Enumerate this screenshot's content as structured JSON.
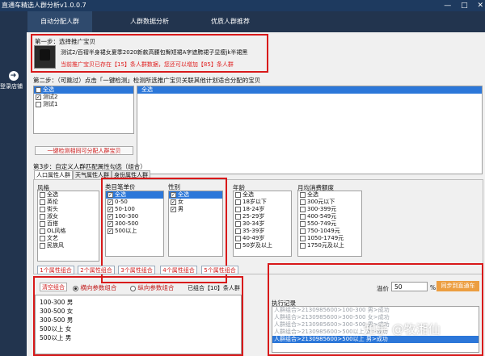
{
  "app": {
    "title": "直通车精选人群分析v1.0.0.7"
  },
  "window_controls": {
    "minimize": "—",
    "maximize": "□",
    "close": "✕"
  },
  "nav": {
    "tabs": [
      "自动分配人群",
      "人群数据分析",
      "优质人群推荐"
    ],
    "active": 0
  },
  "sidebar": {
    "login_label": "登录店铺",
    "login_icon": "arrow-right-circle-icon"
  },
  "step1": {
    "title": "第一步：选择推广宝贝",
    "product_name": "测试2/百褶半身裙女夏季2020新款高腰包臀短裙A字遮胯裙子显瘦jk半裙黑",
    "notice": "当前推广宝贝已存在【15】条人群数据，您还可以增加【85】条人群"
  },
  "step2": {
    "title": "第二步：（可跳过）点击「一键检测」检测所选推广宝贝关联其他计划适合分配的宝贝",
    "left_list": [
      {
        "label": "全选",
        "checked": false,
        "selected": true
      },
      {
        "label": "测试2",
        "checked": true,
        "selected": false
      },
      {
        "label": "测试1",
        "checked": false,
        "selected": false
      }
    ],
    "right_list": [
      {
        "label": "全选",
        "selected": true
      }
    ],
    "detect_button": "一键检测相同可分配人群宝贝"
  },
  "step3": {
    "title": "第3步：自定义人群匹配属性勾选（组合）",
    "tabs": [
      "人口属性人群",
      "天气属性人群",
      "身份属性人群"
    ],
    "active_tab": 0,
    "groups": [
      {
        "name": "风格",
        "items": [
          {
            "label": "全选",
            "checked": false
          },
          {
            "label": "英伦",
            "checked": false
          },
          {
            "label": "街头",
            "checked": false
          },
          {
            "label": "淑女",
            "checked": false
          },
          {
            "label": "百搭",
            "checked": false
          },
          {
            "label": "OL风格",
            "checked": false
          },
          {
            "label": "文艺",
            "checked": false
          },
          {
            "label": "民族风",
            "checked": false
          }
        ]
      },
      {
        "name": "类目笔单价",
        "items": [
          {
            "label": "全选",
            "checked": true,
            "selected": true
          },
          {
            "label": "0-50",
            "checked": true
          },
          {
            "label": "50-100",
            "checked": true
          },
          {
            "label": "100-300",
            "checked": true
          },
          {
            "label": "300-500",
            "checked": true
          },
          {
            "label": "500以上",
            "checked": true
          }
        ]
      },
      {
        "name": "性别",
        "items": [
          {
            "label": "全选",
            "checked": true,
            "selected": true
          },
          {
            "label": "女",
            "checked": true
          },
          {
            "label": "男",
            "checked": true
          }
        ]
      },
      {
        "name": "年龄",
        "items": [
          {
            "label": "全选",
            "checked": false
          },
          {
            "label": "18岁以下",
            "checked": false
          },
          {
            "label": "18-24岁",
            "checked": false
          },
          {
            "label": "25-29岁",
            "checked": false
          },
          {
            "label": "30-34岁",
            "checked": false
          },
          {
            "label": "35-39岁",
            "checked": false
          },
          {
            "label": "40-49岁",
            "checked": false
          },
          {
            "label": "50岁及以上",
            "checked": false
          }
        ]
      },
      {
        "name": "月均消费额度",
        "items": [
          {
            "label": "全选",
            "checked": false
          },
          {
            "label": "300元以下",
            "checked": false
          },
          {
            "label": "300-399元",
            "checked": false
          },
          {
            "label": "400-549元",
            "checked": false
          },
          {
            "label": "550-749元",
            "checked": false
          },
          {
            "label": "750-1049元",
            "checked": false
          },
          {
            "label": "1050-1749元",
            "checked": false
          },
          {
            "label": "1750元及以上",
            "checked": false
          }
        ]
      }
    ],
    "combo_buttons": [
      "1个属性组合",
      "2个属性组合",
      "3个属性组合",
      "4个属性组合",
      "5个属性组合"
    ]
  },
  "bottom_left": {
    "clear_button": "清空组合",
    "radio_horizontal": "横向参数组合",
    "radio_vertical": "纵向参数组合",
    "radio_selected": "horizontal",
    "combined_status": "已组合【10】条人群",
    "results": [
      "100-300 男",
      "300-500 女",
      "300-500 男",
      "500以上 女",
      "500以上 男"
    ]
  },
  "bottom_right": {
    "bid_label": "溢价",
    "bid_value": "50",
    "bid_unit": "%",
    "sync_button": "同步到直通车",
    "log_title": "执行记录",
    "log": [
      "人群组合>2130985600>100-300 男>成功",
      "人群组合>2130985600>300-500 女>成功",
      "人群组合>2130985600>300-500 男>成功",
      "人群组合>2130985600>500以上 女>成功",
      "人群组合>2130985600>500以上 男>成功"
    ]
  },
  "watermark": "知乎 @牧湘仙"
}
